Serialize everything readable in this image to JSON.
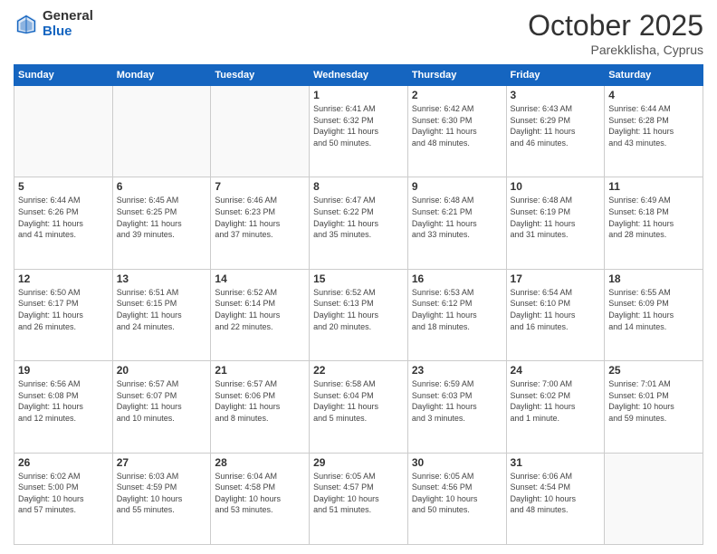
{
  "header": {
    "logo_general": "General",
    "logo_blue": "Blue",
    "title": "October 2025",
    "location": "Parekklisha, Cyprus"
  },
  "weekdays": [
    "Sunday",
    "Monday",
    "Tuesday",
    "Wednesday",
    "Thursday",
    "Friday",
    "Saturday"
  ],
  "weeks": [
    [
      {
        "day": "",
        "info": ""
      },
      {
        "day": "",
        "info": ""
      },
      {
        "day": "",
        "info": ""
      },
      {
        "day": "1",
        "info": "Sunrise: 6:41 AM\nSunset: 6:32 PM\nDaylight: 11 hours\nand 50 minutes."
      },
      {
        "day": "2",
        "info": "Sunrise: 6:42 AM\nSunset: 6:30 PM\nDaylight: 11 hours\nand 48 minutes."
      },
      {
        "day": "3",
        "info": "Sunrise: 6:43 AM\nSunset: 6:29 PM\nDaylight: 11 hours\nand 46 minutes."
      },
      {
        "day": "4",
        "info": "Sunrise: 6:44 AM\nSunset: 6:28 PM\nDaylight: 11 hours\nand 43 minutes."
      }
    ],
    [
      {
        "day": "5",
        "info": "Sunrise: 6:44 AM\nSunset: 6:26 PM\nDaylight: 11 hours\nand 41 minutes."
      },
      {
        "day": "6",
        "info": "Sunrise: 6:45 AM\nSunset: 6:25 PM\nDaylight: 11 hours\nand 39 minutes."
      },
      {
        "day": "7",
        "info": "Sunrise: 6:46 AM\nSunset: 6:23 PM\nDaylight: 11 hours\nand 37 minutes."
      },
      {
        "day": "8",
        "info": "Sunrise: 6:47 AM\nSunset: 6:22 PM\nDaylight: 11 hours\nand 35 minutes."
      },
      {
        "day": "9",
        "info": "Sunrise: 6:48 AM\nSunset: 6:21 PM\nDaylight: 11 hours\nand 33 minutes."
      },
      {
        "day": "10",
        "info": "Sunrise: 6:48 AM\nSunset: 6:19 PM\nDaylight: 11 hours\nand 31 minutes."
      },
      {
        "day": "11",
        "info": "Sunrise: 6:49 AM\nSunset: 6:18 PM\nDaylight: 11 hours\nand 28 minutes."
      }
    ],
    [
      {
        "day": "12",
        "info": "Sunrise: 6:50 AM\nSunset: 6:17 PM\nDaylight: 11 hours\nand 26 minutes."
      },
      {
        "day": "13",
        "info": "Sunrise: 6:51 AM\nSunset: 6:15 PM\nDaylight: 11 hours\nand 24 minutes."
      },
      {
        "day": "14",
        "info": "Sunrise: 6:52 AM\nSunset: 6:14 PM\nDaylight: 11 hours\nand 22 minutes."
      },
      {
        "day": "15",
        "info": "Sunrise: 6:52 AM\nSunset: 6:13 PM\nDaylight: 11 hours\nand 20 minutes."
      },
      {
        "day": "16",
        "info": "Sunrise: 6:53 AM\nSunset: 6:12 PM\nDaylight: 11 hours\nand 18 minutes."
      },
      {
        "day": "17",
        "info": "Sunrise: 6:54 AM\nSunset: 6:10 PM\nDaylight: 11 hours\nand 16 minutes."
      },
      {
        "day": "18",
        "info": "Sunrise: 6:55 AM\nSunset: 6:09 PM\nDaylight: 11 hours\nand 14 minutes."
      }
    ],
    [
      {
        "day": "19",
        "info": "Sunrise: 6:56 AM\nSunset: 6:08 PM\nDaylight: 11 hours\nand 12 minutes."
      },
      {
        "day": "20",
        "info": "Sunrise: 6:57 AM\nSunset: 6:07 PM\nDaylight: 11 hours\nand 10 minutes."
      },
      {
        "day": "21",
        "info": "Sunrise: 6:57 AM\nSunset: 6:06 PM\nDaylight: 11 hours\nand 8 minutes."
      },
      {
        "day": "22",
        "info": "Sunrise: 6:58 AM\nSunset: 6:04 PM\nDaylight: 11 hours\nand 5 minutes."
      },
      {
        "day": "23",
        "info": "Sunrise: 6:59 AM\nSunset: 6:03 PM\nDaylight: 11 hours\nand 3 minutes."
      },
      {
        "day": "24",
        "info": "Sunrise: 7:00 AM\nSunset: 6:02 PM\nDaylight: 11 hours\nand 1 minute."
      },
      {
        "day": "25",
        "info": "Sunrise: 7:01 AM\nSunset: 6:01 PM\nDaylight: 10 hours\nand 59 minutes."
      }
    ],
    [
      {
        "day": "26",
        "info": "Sunrise: 6:02 AM\nSunset: 5:00 PM\nDaylight: 10 hours\nand 57 minutes."
      },
      {
        "day": "27",
        "info": "Sunrise: 6:03 AM\nSunset: 4:59 PM\nDaylight: 10 hours\nand 55 minutes."
      },
      {
        "day": "28",
        "info": "Sunrise: 6:04 AM\nSunset: 4:58 PM\nDaylight: 10 hours\nand 53 minutes."
      },
      {
        "day": "29",
        "info": "Sunrise: 6:05 AM\nSunset: 4:57 PM\nDaylight: 10 hours\nand 51 minutes."
      },
      {
        "day": "30",
        "info": "Sunrise: 6:05 AM\nSunset: 4:56 PM\nDaylight: 10 hours\nand 50 minutes."
      },
      {
        "day": "31",
        "info": "Sunrise: 6:06 AM\nSunset: 4:54 PM\nDaylight: 10 hours\nand 48 minutes."
      },
      {
        "day": "",
        "info": ""
      }
    ]
  ]
}
